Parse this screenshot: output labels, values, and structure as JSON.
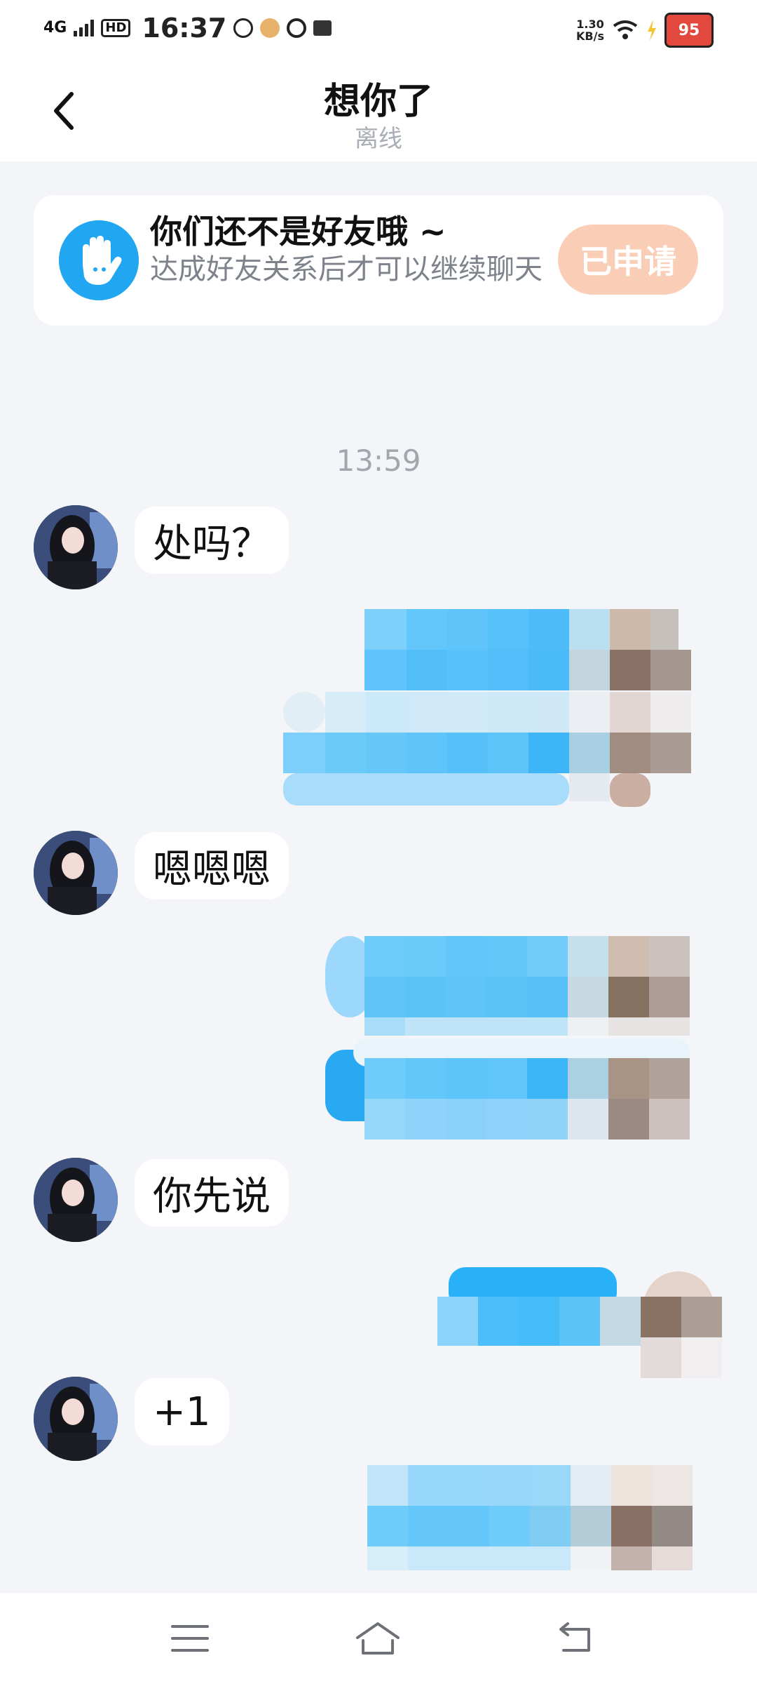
{
  "status_bar": {
    "network": "4G",
    "hd": "HD",
    "time": "16:37",
    "speed_value": "1.30",
    "speed_unit": "KB/s",
    "battery": "95"
  },
  "header": {
    "title": "想你了",
    "status": "离线"
  },
  "banner": {
    "title": "你们还不是好友哦 ~",
    "description": "达成好友关系后才可以继续聊天",
    "applied_button": "已申请"
  },
  "chat": {
    "timestamp": "13:59",
    "messages": [
      {
        "side": "left",
        "text": "处吗？"
      },
      {
        "side": "right",
        "text": ""
      },
      {
        "side": "left",
        "text": "嗯嗯嗯"
      },
      {
        "side": "right",
        "text": ""
      },
      {
        "side": "right",
        "text": ""
      },
      {
        "side": "left",
        "text": "你先说"
      },
      {
        "side": "right",
        "text": ""
      },
      {
        "side": "left",
        "text": "+1"
      },
      {
        "side": "right",
        "text": ""
      }
    ]
  },
  "colors": {
    "page_bg": "#f3f5f8",
    "accent_blue": "#21a6f2",
    "applied_button_bg": "#f9cdb6",
    "bubble_left": "#ffffff"
  },
  "icons": {
    "back": "chevron-left-icon",
    "banner": "hand-wave-icon",
    "nav_menu": "menu-icon",
    "nav_home": "home-icon",
    "nav_back": "return-icon"
  }
}
